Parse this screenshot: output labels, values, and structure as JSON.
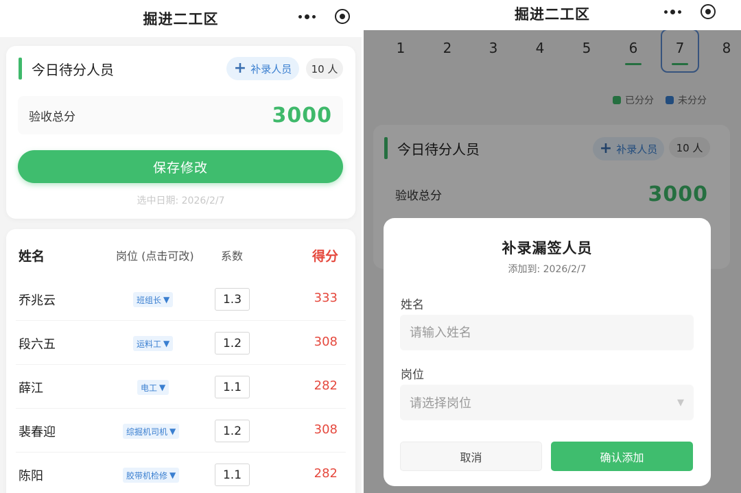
{
  "left": {
    "nav": {
      "title": "掘进二工区"
    },
    "summary": {
      "section_title": "今日待分人员",
      "add_button_label": "补录人员",
      "count_label": "10 人",
      "score_label": "验收总分",
      "score_value": "3000",
      "save_button_label": "保存修改",
      "selected_date_text": "选中日期: 2026/2/7"
    },
    "table": {
      "headers": {
        "name": "姓名",
        "position": "岗位 (点击可改)",
        "coef": "系数",
        "score": "得分"
      },
      "rows": [
        {
          "name": "乔兆云",
          "position": "班组长",
          "coef": "1.3",
          "score": "333"
        },
        {
          "name": "段六五",
          "position": "运料工",
          "coef": "1.2",
          "score": "308"
        },
        {
          "name": "薛江",
          "position": "电工",
          "coef": "1.1",
          "score": "282"
        },
        {
          "name": "裴春迎",
          "position": "综掘机司机",
          "coef": "1.2",
          "score": "308"
        },
        {
          "name": "陈阳",
          "position": "胶带机检修",
          "coef": "1.1",
          "score": "282"
        }
      ]
    }
  },
  "right": {
    "nav": {
      "title": "掘进二工区"
    },
    "dates": [
      "1",
      "2",
      "3",
      "4",
      "5",
      "6",
      "7",
      "8"
    ],
    "legend": {
      "assigned": "已分分",
      "unassigned": "未分分"
    },
    "summary": {
      "section_title": "今日待分人员",
      "add_button_label": "补录人员",
      "count_label": "10 人",
      "score_label": "验收总分",
      "score_value": "3000"
    },
    "modal": {
      "title": "补录漏签人员",
      "subtitle": "添加到: 2026/2/7",
      "name_label": "姓名",
      "name_placeholder": "请输入姓名",
      "position_label": "岗位",
      "position_placeholder": "请选择岗位",
      "cancel_label": "取消",
      "confirm_label": "确认添加"
    }
  },
  "colors": {
    "accent_green": "#3fbd6e",
    "score_red": "#e5483d",
    "tag_blue": "#3a7fd0",
    "legend_assigned": "#3fb96b",
    "legend_unassigned": "#3a7fd0"
  },
  "icons": [
    "more-dots-icon",
    "target-icon",
    "plus-icon",
    "dropdown-triangle-icon"
  ]
}
